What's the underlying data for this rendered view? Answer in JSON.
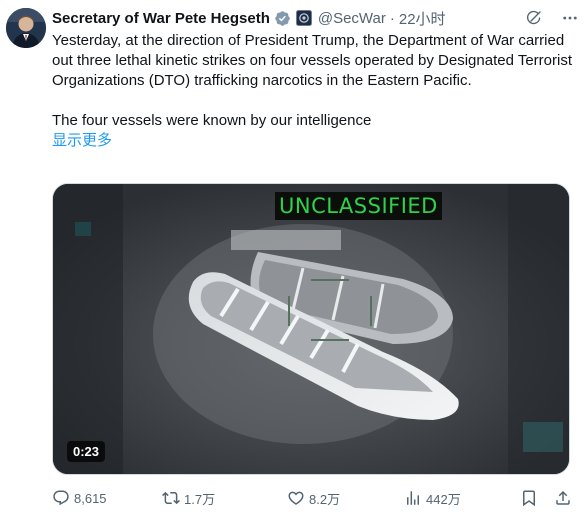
{
  "author": {
    "name": "Secretary of War Pete Hegseth",
    "handle": "@SecWar",
    "separator": "·",
    "time": "22小时"
  },
  "icons": {
    "verified": "verified-badge-icon",
    "flag": "government-flag-icon",
    "grok": "grok-icon",
    "more": "more-options-icon",
    "reply": "reply-icon",
    "retweet": "retweet-icon",
    "like": "like-icon",
    "views": "views-icon",
    "bookmark": "bookmark-icon",
    "share": "share-icon"
  },
  "colors": {
    "link": "#1d9bf0",
    "verified": "#829aab",
    "secondary_text": "#536471",
    "video_label": "#2fd24a"
  },
  "body": {
    "paragraph1": "Yesterday, at the direction of President Trump, the Department of War carried out three lethal kinetic strikes on four vessels operated by Designated Terrorist Organizations (DTO) trafficking narcotics in the Eastern Pacific.",
    "paragraph2": "The four vessels were known by our intelligence",
    "show_more": "显示更多"
  },
  "video": {
    "overlay_label": "UNCLASSIFIED",
    "duration": "0:23"
  },
  "stats": {
    "replies": "8,615",
    "retweets": "1.7万",
    "likes": "8.2万",
    "views": "442万"
  }
}
